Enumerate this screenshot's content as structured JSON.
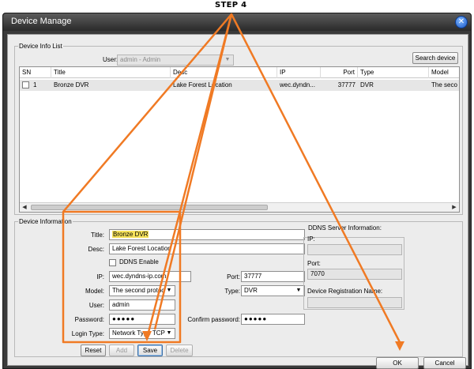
{
  "annotation": {
    "step_label": "STEP 4"
  },
  "window": {
    "title": "Device Manage",
    "close_icon": "close-icon"
  },
  "device_info_list": {
    "group_title": "Device Info List",
    "user_label": "User:",
    "user_value": "admin - Admin",
    "search_button": "Search device",
    "columns": [
      "SN",
      "Title",
      "Desc",
      "IP",
      "Port",
      "Type",
      "Model"
    ],
    "rows": [
      {
        "sn": "1",
        "title": "Bronze DVR",
        "desc": "Lake Forest Location",
        "ip": "wec.dyndn...",
        "port": "37777",
        "type": "DVR",
        "model": "The seco"
      }
    ]
  },
  "device_information": {
    "group_title": "Device Information",
    "title_label": "Title:",
    "title_value": "Bronze DVR",
    "desc_label": "Desc:",
    "desc_value": "Lake Forest Location",
    "ddns_enable_label": "DDNS Enable",
    "ip_label": "IP:",
    "ip_value": "wec.dyndns-ip.com",
    "port_label": "Port:",
    "port_value": "37777",
    "model_label": "Model:",
    "model_value": "The second protoc",
    "type_label": "Type:",
    "type_value": "DVR",
    "user_label": "User:",
    "user_value": "admin",
    "password_label": "Password:",
    "password_value": "●●●●●",
    "confirm_password_label": "Confirm password:",
    "confirm_password_value": "●●●●●",
    "login_type_label": "Login Type:",
    "login_type_value": "Network Type TCP",
    "reset_button": "Reset",
    "add_button": "Add",
    "save_button": "Save",
    "delete_button": "Delete"
  },
  "ddns_server": {
    "heading": "DDNS Server Information:",
    "ip_label": "IP:",
    "ip_value": "",
    "port_label": "Port:",
    "port_value": "7070",
    "registration_label": "Device Registration Name:",
    "registration_value": ""
  },
  "footer": {
    "ok_button": "OK",
    "cancel_button": "Cancel"
  },
  "colors": {
    "annotation": "#f07a24",
    "title_highlight": "#f6e25a",
    "window_frame": "#3a3a3a",
    "dialog_bg": "#ececec"
  }
}
